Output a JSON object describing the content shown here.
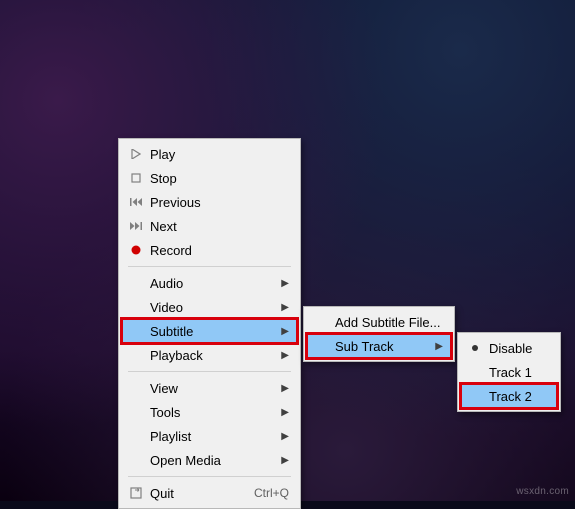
{
  "watermark": "wsxdn.com",
  "main_menu": {
    "play": "Play",
    "stop": "Stop",
    "previous": "Previous",
    "next": "Next",
    "record": "Record",
    "audio": "Audio",
    "video": "Video",
    "subtitle": "Subtitle",
    "playback": "Playback",
    "view": "View",
    "tools": "Tools",
    "playlist": "Playlist",
    "open_media": "Open Media",
    "quit": "Quit",
    "quit_shortcut": "Ctrl+Q"
  },
  "subtitle_menu": {
    "add_file": "Add Subtitle File...",
    "sub_track": "Sub Track"
  },
  "track_menu": {
    "disable": "Disable",
    "track1": "Track 1",
    "track2": "Track 2"
  }
}
